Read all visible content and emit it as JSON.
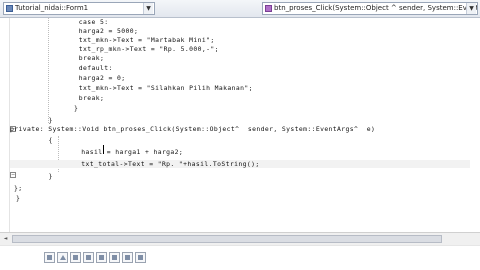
{
  "header": {
    "class_combo": "Tutorial_nidai::Form1",
    "method_combo": "btn_proses_Click(System::Object ^ sender, System::EventArgs ^ e)"
  },
  "code_lines": [
    "           case 5:",
    "           harga2 = 5000;",
    "           txt_mkn->Text = \"Martabak Mini\";",
    "           txt_rp_mkn->Text = \"Rp. 5.000,-\";",
    "           break;",
    "           default:",
    "           harga2 = 0;",
    "           txt_mkn->Text = \"Silahkan Pilih Makanan\";",
    "           break;",
    "        }",
    "  }",
    "private: System::Void btn_proses_Click(System::Object^  sender, System::EventArgs^  e)",
    "  {",
    "     hasil = harga1 + harga2;",
    "     txt_total->Text = \"Rp. \"+hasil.ToString();",
    "  }",
    "};",
    "}"
  ],
  "icons": {
    "class_icon": "class-icon",
    "method_icon": "method-icon",
    "fold_collapse": "minus-fold-icon"
  },
  "taskbar_buttons": [
    "window-icon",
    "triangle-icon",
    "document-icon",
    "folder-icon",
    "grid-icon",
    "terminal-icon",
    "list-icon",
    "settings-icon"
  ]
}
